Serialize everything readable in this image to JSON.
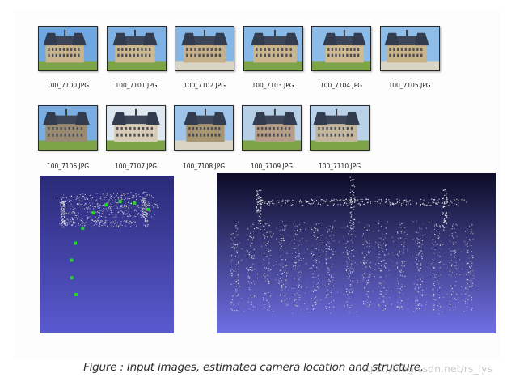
{
  "thumbnails": {
    "row1": [
      {
        "filename": "100_7100.JPG",
        "sky": "#6fa8e0",
        "wall": "#c9b48c"
      },
      {
        "filename": "100_7101.JPG",
        "sky": "#7fb2e4",
        "wall": "#cdb98f"
      },
      {
        "filename": "100_7102.JPG",
        "sky": "#84b6e6",
        "wall": "#c6b089"
      },
      {
        "filename": "100_7103.JPG",
        "sky": "#86b8e8",
        "wall": "#cbb58d"
      },
      {
        "filename": "100_7104.JPG",
        "sky": "#8bbbe8",
        "wall": "#d0bb93"
      },
      {
        "filename": "100_7105.JPG",
        "sky": "#8ebde9",
        "wall": "#c8b28a"
      }
    ],
    "row2": [
      {
        "filename": "100_7106.JPG",
        "sky": "#7aaee2",
        "wall": "#9a8a70"
      },
      {
        "filename": "100_7107.JPG",
        "sky": "#dfe8f0",
        "wall": "#d8cdb4"
      },
      {
        "filename": "100_7108.JPG",
        "sky": "#9ec4ea",
        "wall": "#a89572"
      },
      {
        "filename": "100_7109.JPG",
        "sky": "#b6cfe6",
        "wall": "#b59d86"
      },
      {
        "filename": "100_7110.JPG",
        "sky": "#b9d2ea",
        "wall": "#c4b69c"
      }
    ]
  },
  "left_view": {
    "bg_top": "#2a2a78",
    "bg_bottom": "#5a5ad0",
    "camera_color": "#22d822",
    "camera_count": 10
  },
  "right_view": {
    "bg_top": "#0c0c26",
    "bg_bottom": "#7070e6"
  },
  "caption": "Figure : Input images, estimated camera location and structure.",
  "watermark": "https://blog.csdn.net/rs_lys"
}
